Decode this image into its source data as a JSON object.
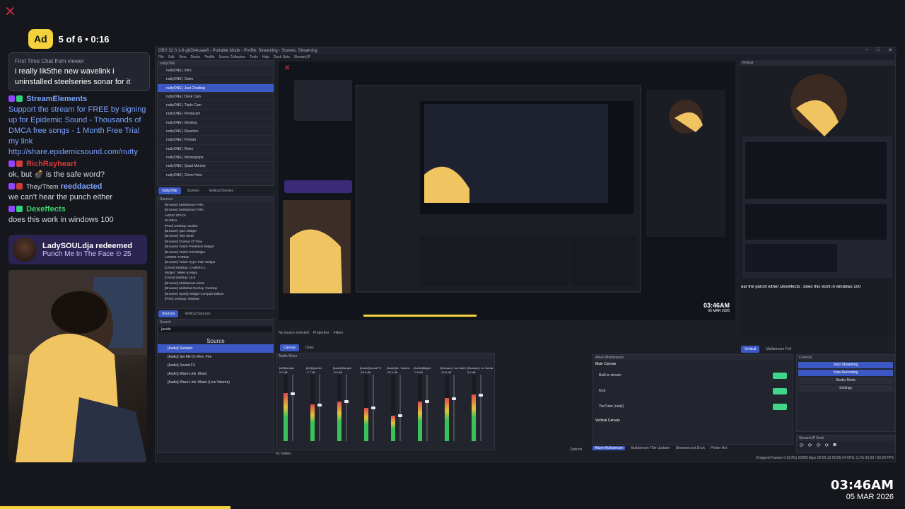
{
  "ad": {
    "badge": "Ad",
    "text": "5 of 6 • 0:16"
  },
  "chat": {
    "first_chat_label": "First Time Chat from viewer",
    "first_chat_text": "i really lik5the new wavelink i uninstalled steelseries sonar for it",
    "messages": [
      {
        "name": "StreamElements",
        "color": "blue",
        "text": "Support the stream for FREE by signing up for Epidemic Sound - Thousands of DMCA free songs - 1 Month Free Trial my link",
        "link": "http://share.epidemicsound.com/nutty"
      },
      {
        "name": "RichRayheart",
        "color": "red",
        "text": "ok, but 💣 is the safe word?"
      },
      {
        "name": "reeddacted",
        "prefix": "They/Them",
        "color": "blue",
        "text": "we can't hear the punch either"
      },
      {
        "name": "Dexeffects",
        "color": "green",
        "text": "does this work in windows 100"
      }
    ],
    "redeem": {
      "name": "LadySOULdja redeemed",
      "reward": "Punch Me In The Face ⏲ 25"
    }
  },
  "obs": {
    "title": "OBS 32.0.1-6-g82b4caae8 - Portable Mode - Profile: Streaming - Scenes: Streaming",
    "menu": [
      "File",
      "Edit",
      "View",
      "Docks",
      "Profile",
      "Scene Collection",
      "Tools",
      "Help",
      "Dock Sets",
      "StreamUP"
    ],
    "scene_panel_title": "nuttyONE",
    "scenes": [
      "nuttyONE | Intro",
      "nuttyONE | Outro",
      "nuttyONE | Just Chatting",
      "nuttyONE | Desk Cam",
      "nuttyONE | Triple Cam",
      "nuttyONE | Pentacam",
      "nuttyONE | Desktop",
      "nuttyONE | Reaction",
      "nuttyONE | Portrait",
      "nuttyONE | Retro",
      "nuttyONE | Monkeytype",
      "nuttyONE | Quad Monitor",
      "nuttyONE | Clone Hero"
    ],
    "selected_scene": 2,
    "scene_tabs": [
      "nuttyONE",
      "Scenes",
      "Vertical Scenes"
    ],
    "sources_title": "Sources",
    "sources": [
      "[Browser] Multistream Polls",
      "[Browser] Multistream Polls",
      "AUDIO STACK",
      "GLOBAL",
      "[PNG] Desktop: Outline",
      "[Browser] Q&A Widget",
      "[Browser] Vibe Meter",
      "[Browser] Ocarina Of Time",
      "[Browser] Twitch Prediction Widget",
      "[Browser] Twitch Poll Widget",
      "LOWER THIRDS",
      "[Browser] Twitch Hype Train Widget",
      "[Clone] Desktop: CAMERA A",
      "Widget : Mikes & Maya",
      "[Clone] Desktop: 16:9",
      "[Browser] Multistream Alerts",
      "[Browser] Multichat Overlay: Desktop",
      "[Browser] Spotify Widget Compact Edition",
      "[PNG] Desktop: Shadow"
    ],
    "source_tabs": [
      "Sources",
      "Vertical Sources"
    ],
    "search_title": "Search",
    "search_value": "[audio",
    "search_header": "Source",
    "search_results": [
      "[Audio] Sampler",
      "[Audio] Set Me On Fire: Fire",
      "[Audio] Sound FX",
      "[Audio] Wave Link: Music",
      "[Audio] Wave Link: Music (Low Volume)"
    ],
    "no_source": "No source selected",
    "properties": "Properties",
    "filters": "Filters",
    "canvas_tabs": [
      "Canvas",
      "Draw"
    ],
    "vertical_title": "Vertical",
    "vertical_tabs": [
      "Vertical",
      "Multistream Poll"
    ],
    "audio_mixer_title": "Audio Mixer",
    "mixer_channels": [
      "[AS]Sample",
      "[AS]Spleeter",
      "[Audio]Sample",
      "[Audio]Sound FX",
      "[Audio]W...Volume",
      "[Audio]Blipper",
      "[Browser]...ken Alerts",
      "[Browser]...le Overlay"
    ],
    "mixer_levels": [
      0.72,
      0.55,
      0.6,
      0.5,
      0.38,
      0.6,
      0.65,
      0.7
    ],
    "mixer_db": [
      "0.0 dB",
      "-7.7 dB",
      "-8.0 dB",
      "-15.0 dB",
      "-20.0 dB",
      "-7.8 dB",
      "-10.0 dB",
      "0.0 dB"
    ],
    "hidden_count": "42 hidden",
    "options": "Options",
    "multistream_title": "Aitum Multistream",
    "main_canvas": "Main Canvas",
    "outputs": [
      "Built-in stream",
      "Kick",
      "YouTube (nutty)"
    ],
    "vertical_canvas": "Vertical Canvas",
    "bottom_tabs": [
      "Aitum Multistream",
      "Multistream Title Updater",
      "Streamer.bot Dock",
      "Printer Bot"
    ],
    "controls_title": "Controls",
    "controls": [
      "Stop Streaming",
      "Stop Recording",
      "Studio Mode",
      "Settings"
    ],
    "streamup_title": "StreamUP Dock",
    "status": "Dropped Frames 0 (0.0%)   22965 kbps   02:05:13   02:05:14   CPU: 3.1%  60.00 / 60.00 FPS",
    "preview_clock": "03:46AM",
    "preview_date": "05 MAR 2026",
    "vertical_ticker": "ear the punch either  Dexeffects : does this work in windows 100"
  },
  "clock": {
    "time": "03:46AM",
    "date": "05 MAR 2026"
  }
}
